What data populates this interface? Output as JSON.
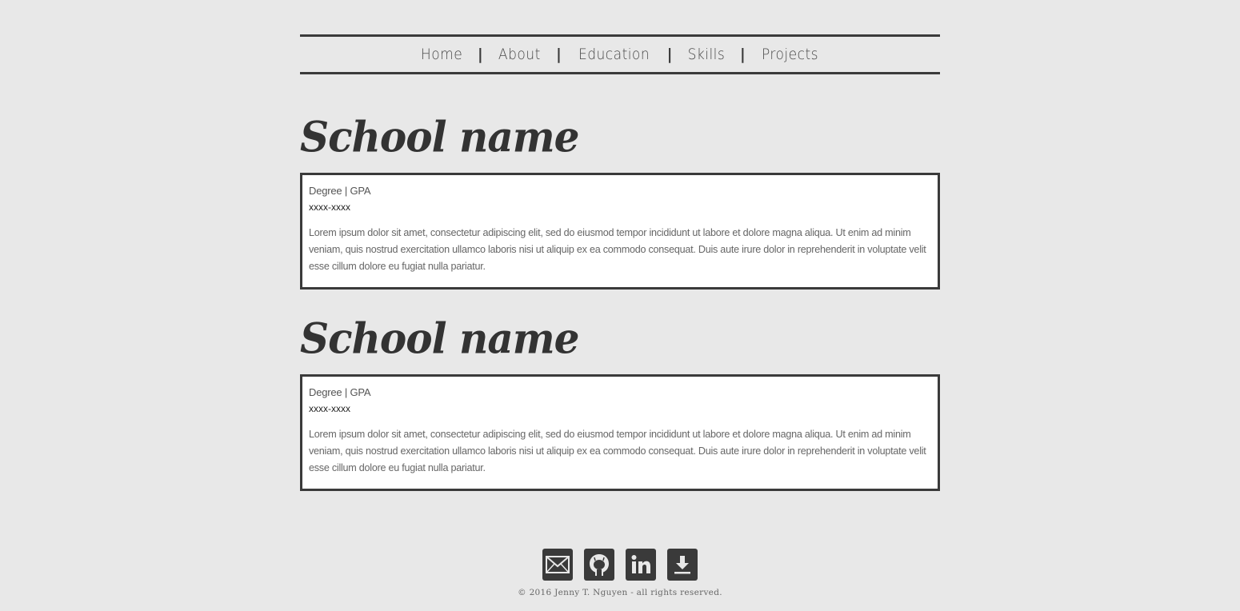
{
  "nav": {
    "items": [
      "Home",
      "About",
      "Education",
      "Skills",
      "Projects"
    ],
    "separator": "|"
  },
  "schools": [
    {
      "name": "School name",
      "degree": "Degree | GPA",
      "years": "xxxx-xxxx",
      "description": "Lorem ipsum dolor sit amet, consectetur adipiscing elit, sed do eiusmod tempor incididunt ut labore et dolore magna aliqua. Ut enim ad minim veniam, quis nostrud exercitation ullamco laboris nisi ut aliquip ex ea commodo consequat. Duis aute irure dolor in reprehenderit in voluptate velit esse cillum dolore eu fugiat nulla pariatur."
    },
    {
      "name": "School name",
      "degree": "Degree | GPA",
      "years": "xxxx-xxxx",
      "description": "Lorem ipsum dolor sit amet, consectetur adipiscing elit, sed do eiusmod tempor incididunt ut labore et dolore magna aliqua. Ut enim ad minim veniam, quis nostrud exercitation ullamco laboris nisi ut aliquip ex ea commodo consequat. Duis aute irure dolor in reprehenderit in voluptate velit esse cillum dolore eu fugiat nulla pariatur."
    }
  ],
  "footer": {
    "icons": [
      "mail-icon",
      "github-icon",
      "linkedin-icon",
      "download-icon"
    ],
    "copyright": "© 2016 Jenny T. Nguyen - all rights reserved."
  },
  "colors": {
    "background": "#e8e8e8",
    "dark": "#3a3a3a",
    "card": "#ffffff"
  }
}
